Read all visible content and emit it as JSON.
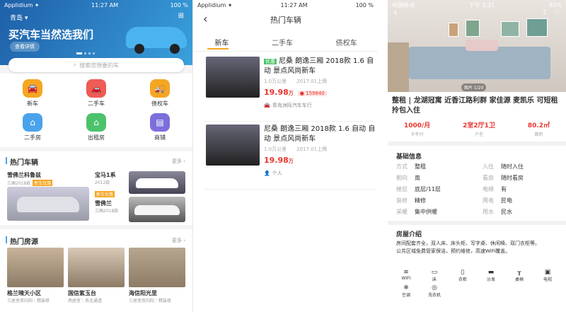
{
  "p1": {
    "status": {
      "carrier": "Applidium",
      "time": "11:27 AM",
      "battery": "100 %"
    },
    "city": "青岛",
    "banner": {
      "title": "买汽车当然选我们",
      "btn": "查看详情"
    },
    "search_placeholder": "搜索您想要的车",
    "cats": [
      {
        "label": "新车",
        "color": "#f5a623",
        "icon": "car-icon"
      },
      {
        "label": "二手车",
        "color": "#ef5b55",
        "icon": "used-car-icon"
      },
      {
        "label": "债权车",
        "color": "#f5a623",
        "icon": "truck-icon"
      },
      {
        "label": "二手房",
        "color": "#4aa3ea",
        "icon": "house-icon"
      },
      {
        "label": "出租房",
        "color": "#4cc36b",
        "icon": "rental-house-icon"
      },
      {
        "label": "商铺",
        "color": "#7c6fdc",
        "icon": "shop-icon"
      }
    ],
    "hot_cars": {
      "title": "热门车辆",
      "more": "更多",
      "a": {
        "name": "雪佛兰科鲁兹",
        "sub": "三厢2018款",
        "tag": "新车优惠"
      },
      "b": {
        "name": "宝马1系",
        "year": "2012款",
        "tag": "新车优惠"
      },
      "c": {
        "name": "雪佛兰",
        "sub": "三厢2018款"
      }
    },
    "hot_homes": {
      "title": "热门房源",
      "more": "更多",
      "items": [
        {
          "name": "格兰晴天小区",
          "sub": "三居室双向阳｜精装修"
        },
        {
          "name": "国信紫玉台",
          "sub": "两居室｜南北通透"
        },
        {
          "name": "海信阳光里",
          "sub": "三居室双向阳｜精装修"
        }
      ]
    }
  },
  "p2": {
    "status": {
      "carrier": "Applidium",
      "time": "11:27 AM",
      "battery": "100 %"
    },
    "title": "热门车辆",
    "tabs": [
      "新车",
      "二手车",
      "债权车"
    ],
    "listings": [
      {
        "badge": "优惠",
        "title": "尼桑 朗逸三厢 2018款 1.6 自动 景点风尚新车",
        "km": "1.0万公里",
        "date": "2017.01上牌",
        "price": "19.98",
        "unit": "万",
        "views": "159840",
        "seller": "青岛洲际汽车车行"
      },
      {
        "title": "尼桑 朗逸三厢 2018款 1.6 自动 自动 景点风尚新车",
        "km": "1.0万公里",
        "date": "2017.01上牌",
        "price": "19.98",
        "unit": "万",
        "seller": "个人"
      }
    ]
  },
  "p3": {
    "status": {
      "carrier": "中国移动",
      "time": "下午 3:31",
      "battery": "83%"
    },
    "photo": "图片 1/20",
    "title": "整租 | 龙湖冠寓 近香江路利群 家佳源 麦凯乐 可短租 拎包入住",
    "stats": [
      {
        "v": "1000/月",
        "l": "半年付"
      },
      {
        "v": "2室2厅1卫",
        "l": "户型"
      },
      {
        "v": "80.2㎡",
        "l": "面积"
      }
    ],
    "basic": {
      "title": "基础信息",
      "rows": [
        [
          "方式",
          "整租",
          "入住",
          "随时入住"
        ],
        [
          "朝向",
          "南",
          "看房",
          "随时看房"
        ],
        [
          "楼层",
          "底层/11层",
          "电梯",
          "有"
        ],
        [
          "装修",
          "精修",
          "用电",
          "民电"
        ],
        [
          "采暖",
          "集中供暖",
          "用水",
          "民水"
        ]
      ]
    },
    "intro": {
      "title": "房屋介绍",
      "text": "房间配套齐全，双人床、床头柜、写字桌、休闲椅、双门衣柜等。",
      "text2": "公共区域免费管家保洁，预约维修，高速WiFi覆盖。"
    },
    "amenities": [
      "WIFI",
      "床",
      "衣柜",
      "沙发",
      "桌椅",
      "电视",
      "空调",
      "洗衣机"
    ]
  }
}
